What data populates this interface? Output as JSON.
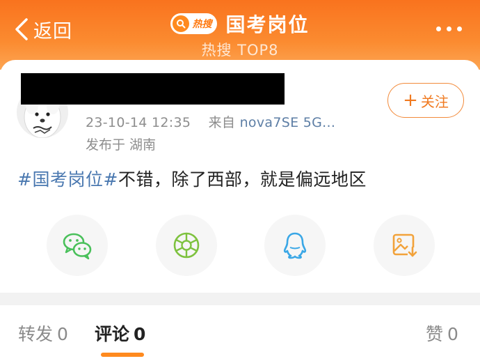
{
  "header": {
    "back_label": "返回",
    "badge_label": "热搜",
    "title": "国考岗位",
    "subtitle": "热搜 TOP8"
  },
  "post": {
    "timestamp": "23-10-14 12:35",
    "source_prefix": "来自",
    "device": "nova7SE 5G...",
    "location": "发布于 湖南",
    "hashtag": "#国考岗位#",
    "body": "不错，除了西部，就是偏远地区",
    "follow_label": "关注"
  },
  "share_icons": [
    "wechat-icon",
    "moments-icon",
    "qq-icon",
    "save-image-icon"
  ],
  "tabs": {
    "repost": {
      "label": "转发",
      "count": "0"
    },
    "comment": {
      "label": "评论",
      "count": "0"
    },
    "like": {
      "label": "赞",
      "count": "0"
    }
  },
  "colors": {
    "accent": "#f97a1e",
    "hashtag": "#4a78b0",
    "wechat": "#49c05a",
    "moments": "#7ec23f",
    "qq": "#3aa7e6",
    "save": "#f2a23a"
  }
}
